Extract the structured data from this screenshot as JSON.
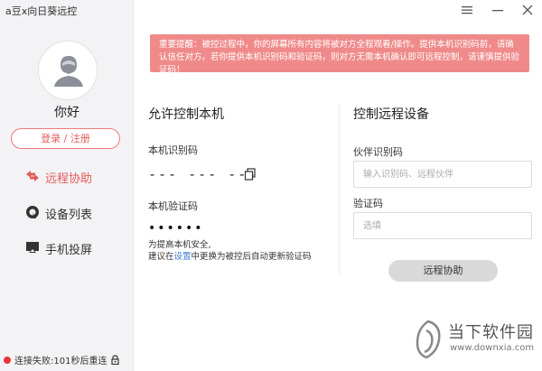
{
  "app": {
    "title": "a豆x向日葵远控"
  },
  "sidebar": {
    "greeting": "你好",
    "login_label": "登录 / 注册",
    "items": [
      {
        "label": "远程协助",
        "icon": "remote-assist-icon",
        "active": true
      },
      {
        "label": "设备列表",
        "icon": "device-list-icon",
        "active": false
      },
      {
        "label": "手机投屏",
        "icon": "screen-cast-icon",
        "active": false
      }
    ],
    "status": "连接失败:101秒后重连"
  },
  "window": {
    "menu_icon": "menu-icon",
    "minimize_icon": "minimize-icon",
    "close_icon": "close-icon"
  },
  "notice": {
    "text": "重要提醒：被控过程中，你的屏幕所有内容将被对方全程观看/操作。提供本机识别码前，请确认信任对方。若你提供本机识别码和验证码，则对方无需本机确认即可远程控制，请谨慎提供验证码！"
  },
  "allow": {
    "title": "允许控制本机",
    "id_label": "本机识别码",
    "id_value": "--- --- ---",
    "code_label": "本机验证码",
    "code_value": "••••••",
    "hint_line1": "为提高本机安全,",
    "hint_prefix": "建议在",
    "hint_link": "设置",
    "hint_suffix": "中更换为被控后自动更新验证码"
  },
  "remote": {
    "title": "控制远程设备",
    "partner_label": "伙伴识别码",
    "partner_placeholder": "输入识别码、远程伙伴",
    "code_label": "验证码",
    "code_placeholder": "选填",
    "button_label": "远程协助"
  },
  "watermark": {
    "text": "当下软件园",
    "url": "www.downxia.com"
  },
  "colors": {
    "accent": "#e35a5a",
    "notice_bg": "#f08a8a",
    "sidebar_bg": "#f3f3f5",
    "link": "#3a7bd5",
    "status_dot": "#e8333b"
  }
}
